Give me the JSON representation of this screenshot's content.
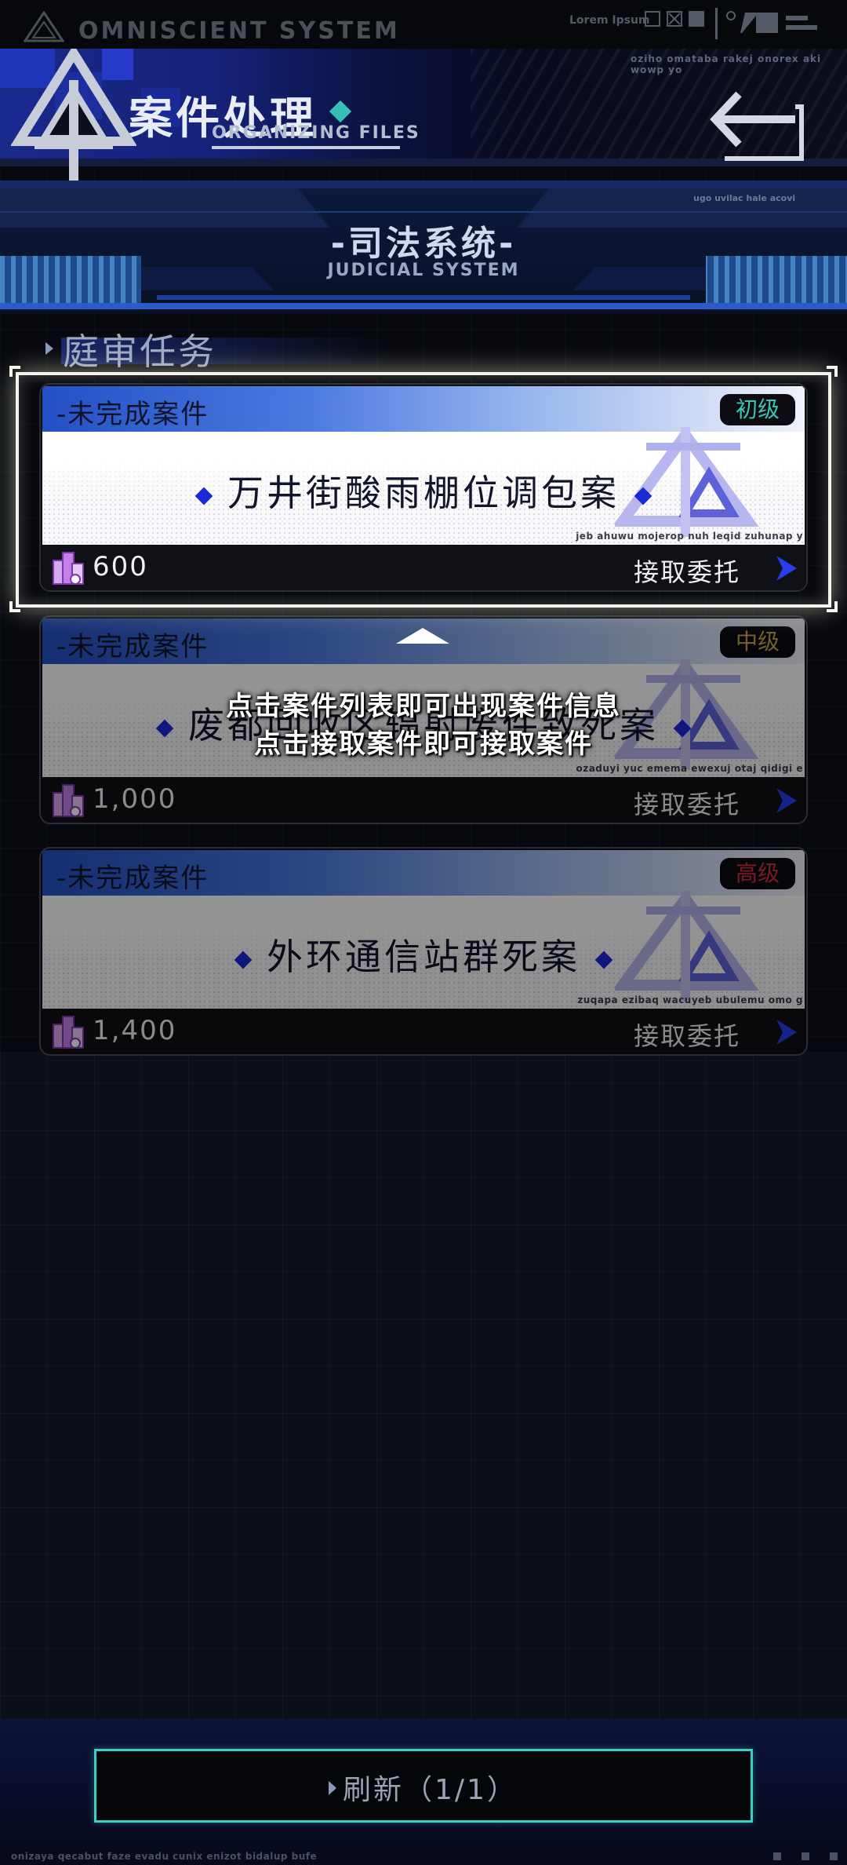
{
  "status_bar": {
    "system_title": "OMNISCIENT SYSTEM",
    "lorem_text": "Lorem Ipsum"
  },
  "header": {
    "title": "案件处理",
    "subtitle": "ORGANIZING FILES",
    "mono_text": "oziho omataba rakej onorex aki wowp yo",
    "back_icon": "back-arrow-icon"
  },
  "banner": {
    "title": "-司法系统-",
    "subtitle": "JUDICIAL SYSTEM",
    "mono_text": "ugo uvilac hale acovi"
  },
  "section": {
    "heading": "庭审任务"
  },
  "cases": [
    {
      "status": "-未完成案件",
      "level": "初级",
      "level_color": "#3cc6b4",
      "name": "万井街酸雨棚位调包案",
      "mono_text": "jeb ahuwu mojerop nuh leqid zuhunap y",
      "reward": "600",
      "accept_label": "接取委托"
    },
    {
      "status": "-未完成案件",
      "level": "中级",
      "level_color": "#c8a24a",
      "name": "废都回收区辐射废件致死案",
      "mono_text": "ozaduyi yuc emema ewexuj otaj qidigi e",
      "reward": "1,000",
      "accept_label": "接取委托"
    },
    {
      "status": "-未完成案件",
      "level": "高级",
      "level_color": "#d0303a",
      "name": "外环通信站群死案",
      "mono_text": "zuqapa ezibaq wacuyeb ubulemu omo g",
      "reward": "1,400",
      "accept_label": "接取委托"
    }
  ],
  "tutorial": {
    "line1": "点击案件列表即可出现案件信息",
    "line2": "点击接取案件即可接取案件"
  },
  "refresh": {
    "label": "刷新（1/1）"
  },
  "footer": {
    "mono_text": "onizaya qecabut faze evadu cunix enizot bidalup bufe"
  },
  "colors": {
    "accent_cyan": "#3ad0c8",
    "accent_blue": "#1a28d8",
    "header_blue": "#1a2a8a"
  }
}
